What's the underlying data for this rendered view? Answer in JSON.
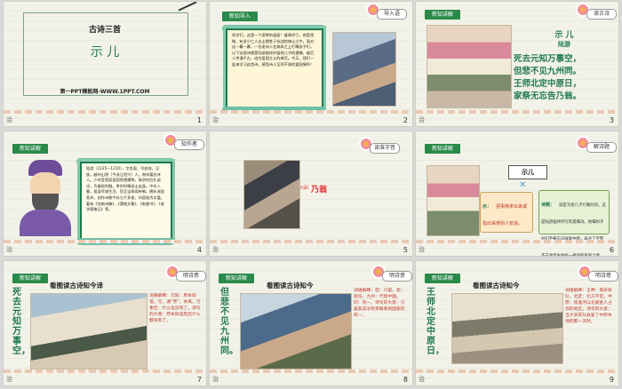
{
  "slides": [
    {
      "num": "1",
      "title": "古诗三首",
      "subtitle": "示  儿",
      "footer": "第一PPT模板网-WWW.1PPT.COM",
      "bottom_left": "治"
    },
    {
      "num": "2",
      "tag": "新知导入",
      "badge": "导入语",
      "text": "同学们，这是一个悲惨的画面！瘦骨伶仃，饱受侵略，有多少仁人志士牺牲于抗战的烽火之中，面对这一幕一幕，一位老诗人在病床之上叮嘱孩子们，以下这首诗就是陆游临终时留给儿子的遗嘱，被后人传诵千古，成为爱国主义的典范。今天，我们一起来学习这首诗，感受诗人至死不渝的爱国情怀！",
      "bottom_left": "治"
    },
    {
      "num": "3",
      "tag": "新知讲解",
      "badge": "读古诗",
      "poem_title": "示  儿",
      "author": "陆游",
      "lines": [
        "死去元知万事空，",
        "但悲不见九州同。",
        "王师北定中原日，",
        "家祭无忘告乃翁。"
      ],
      "bottom_left": "治"
    },
    {
      "num": "4",
      "tag": "新知讲解",
      "badge": "知作者",
      "text": "陆游（1125—1210），字务观，号放翁，汉族，越州山阴（今浙江绍兴）人，南宋著名诗人。少时受家庭爱国思想熏陶，高宗时应礼部试，为秦桧所黜。孝宗时赐进士出身。中年入蜀，投身军旅生活，官至宝章阁待制。晚年退居家乡。创作诗歌今存九千多首，内容极为丰富。著有《剑南诗稿》、《渭南文集》、《南唐书》、《老学庵笔记》等。",
      "bottom_left": "治"
    },
    {
      "num": "5",
      "badge": "读准字音",
      "word": "乃翁",
      "pinyin": "nǎi",
      "bottom_left": "治"
    },
    {
      "num": "6",
      "tag": "新知讲解",
      "badge": "解诗题",
      "poem_title": "示儿",
      "label1": "示：",
      "explain1": "把事物拿出来或指出来使别人知道。",
      "label2": "诗题：",
      "explain2": "就是写给儿子们看的诗，这是陆游临终时写的遗嘱诗。他嘱咐子孙们不要忘记收复中原，表达了至死不忘收复失地统一祖国的爱国之情。",
      "bottom_left": "治"
    },
    {
      "num": "7",
      "tag": "新知讲解",
      "badge": "明诗意",
      "heading": "看图读古诗知今译",
      "vertical": "死去元知万事空，",
      "notes": "词语解释：元知：原本知道。元，通“原”。本来。万事空：什么也没有了。诗句的大意：原本知道死后什么都没有了。",
      "bottom_left": "治"
    },
    {
      "num": "8",
      "tag": "新知讲解",
      "badge": "明诗意",
      "heading": "看图读古诗知今",
      "vertical": "但悲不见九州同。",
      "notes": "词语解释：但：只是。悲：悲伤。九州：代指中国。同：统一。诗句的大意：只是悲哀没有亲眼看到国家的统一。",
      "bottom_left": "治"
    },
    {
      "num": "9",
      "tag": "新知讲解",
      "badge": "明诗意",
      "heading": "看图读古诗知今",
      "vertical": "王师北定中原日，",
      "notes": "词语解释：王师：南宋军队。北定：北方平定。中原：指淮河以北被金人占领的地区。诗句的大意：当大宋军队收复了中原失地的那一天时。",
      "bottom_left": "治"
    }
  ]
}
